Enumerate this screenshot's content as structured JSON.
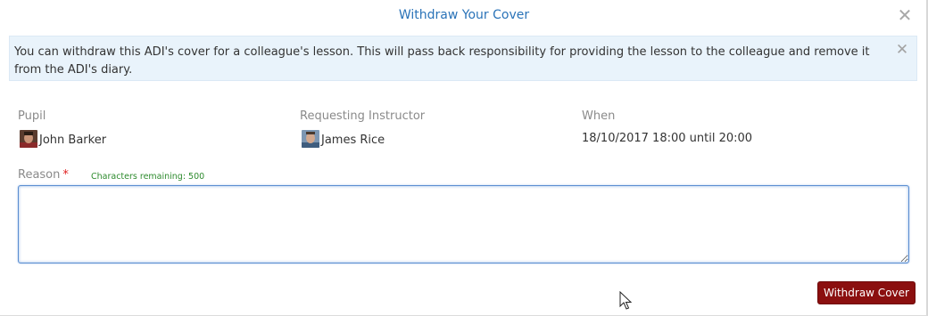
{
  "modal": {
    "title": "Withdraw Your Cover",
    "close_icon": "close-icon"
  },
  "alert": {
    "message": "You can withdraw this ADI's cover for a colleague's lesson. This will pass back responsibility for providing the lesson to the colleague and remove it from the ADI's diary.",
    "close_icon": "close-icon"
  },
  "details": {
    "pupil": {
      "label": "Pupil",
      "name": "John Barker",
      "avatar": "avatar-icon"
    },
    "instructor": {
      "label": "Requesting Instructor",
      "name": "James Rice",
      "avatar": "avatar-icon"
    },
    "when": {
      "label": "When",
      "value": "18/10/2017 18:00 until 20:00"
    }
  },
  "reason": {
    "label": "Reason",
    "required_marker": "*",
    "chars_remaining": "Characters remaining: 500",
    "value": "",
    "placeholder": ""
  },
  "actions": {
    "withdraw_label": "Withdraw Cover"
  },
  "colors": {
    "title": "#2a73b8",
    "alert_bg": "#e9f3fb",
    "button_bg": "#8b0f0f",
    "chars_text": "#2e8b2e",
    "required": "#e02020"
  }
}
